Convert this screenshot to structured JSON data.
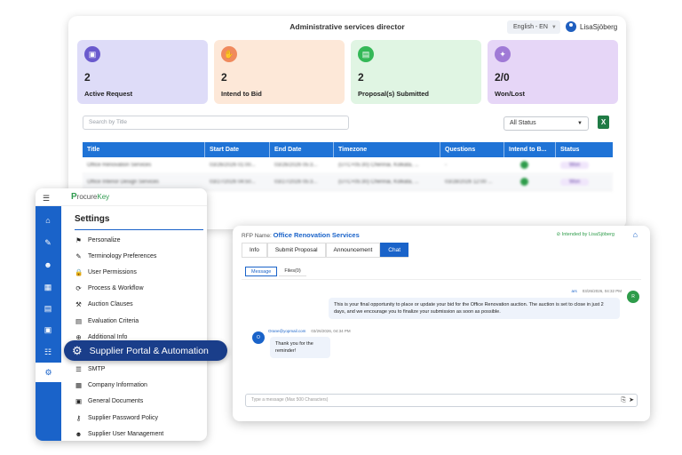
{
  "dashboard": {
    "title": "Administrative services director",
    "language": "English - EN",
    "user": "LisaSjöberg",
    "cards": [
      {
        "value": "2",
        "label": "Active Request",
        "bg": "#dedcf8",
        "icon_bg": "#6a5acd",
        "icon": "briefcase-icon"
      },
      {
        "value": "2",
        "label": "Intend to Bid",
        "bg": "#fde8d8",
        "icon_bg": "#f08a5d",
        "icon": "hand-icon"
      },
      {
        "value": "2",
        "label": "Proposal(s) Submitted",
        "bg": "#e0f5e3",
        "icon_bg": "#34b857",
        "icon": "document-icon"
      },
      {
        "value": "2/0",
        "label": "Won/Lost",
        "bg": "#e6d6f7",
        "icon_bg": "#a07ad6",
        "icon": "trophy-icon"
      }
    ],
    "search_placeholder": "Search by Title",
    "status_filter": "All Status",
    "table": {
      "headers": [
        "Title",
        "Start Date",
        "End Date",
        "Timezone",
        "Questions",
        "Intend to B...",
        "Status"
      ],
      "rows": [
        {
          "title": "Office Renovation Services",
          "start": "03/26/2026 01:00...",
          "end": "03/26/2026 05:3...",
          "timezone": "(UTC+05:30) Chennai, Kolkata, ...",
          "questions": "-",
          "status": "Won"
        },
        {
          "title": "Office Interior Design Services",
          "start": "03/27/2026 04:50...",
          "end": "03/27/2026 05:3...",
          "timezone": "(UTC+05:30) Chennai, Kolkata, ...",
          "questions": "03/28/2026 12:00 ...",
          "status": "Won"
        }
      ]
    }
  },
  "settings": {
    "logo_prefix": "P",
    "logo_main": "rocure",
    "logo_suffix": "Key",
    "heading": "Settings",
    "items": [
      {
        "label": "Personalize",
        "icon": "flag-icon",
        "glyph": "⚑"
      },
      {
        "label": "Terminology Preferences",
        "icon": "palette-icon",
        "glyph": "✎"
      },
      {
        "label": "User Permissions",
        "icon": "lock-icon",
        "glyph": "🔒"
      },
      {
        "label": "Process & Workflow",
        "icon": "refresh-icon",
        "glyph": "⟳"
      },
      {
        "label": "Auction Clauses",
        "icon": "gavel-icon",
        "glyph": "⚒"
      },
      {
        "label": "Evaluation Criteria",
        "icon": "chart-icon",
        "glyph": "▤"
      },
      {
        "label": "Additional Info",
        "icon": "plus-circle-icon",
        "glyph": "⊕"
      },
      {
        "label": "SMTP",
        "icon": "server-icon",
        "glyph": "☰"
      },
      {
        "label": "Company Information",
        "icon": "building-icon",
        "glyph": "▦"
      },
      {
        "label": "General Documents",
        "icon": "document-icon",
        "glyph": "▣"
      },
      {
        "label": "Supplier Password Policy",
        "icon": "key-icon",
        "glyph": "⚷"
      },
      {
        "label": "Supplier User Management",
        "icon": "users-icon",
        "glyph": "☻"
      }
    ],
    "highlight": "Supplier Portal & Automation"
  },
  "chat": {
    "rfp_label": "RFP Name:",
    "rfp_name": "Office Renovation Services",
    "intended": "Intended by LisaSjöberg",
    "tabs": [
      "Info",
      "Submit Proposal",
      "Announcement",
      "Chat"
    ],
    "subtabs": [
      "Message",
      "Files(0)"
    ],
    "msg_right": {
      "who": "ars",
      "time": "03/26/2026, 04:32 PM",
      "avatar": "R",
      "text": "This is your final opportunity to place or update your bid for the Office Renovation auction. The auction is set to close in just 2 days, and we encourage you to finalize your submission as soon as possible."
    },
    "msg_left": {
      "who": "Orane@yopmail.com",
      "time": "03/26/2026, 04:34 PM",
      "avatar": "O",
      "text": "Thank you for the reminder!"
    },
    "composer_placeholder": "Type a message (Max 500 Characters)"
  }
}
